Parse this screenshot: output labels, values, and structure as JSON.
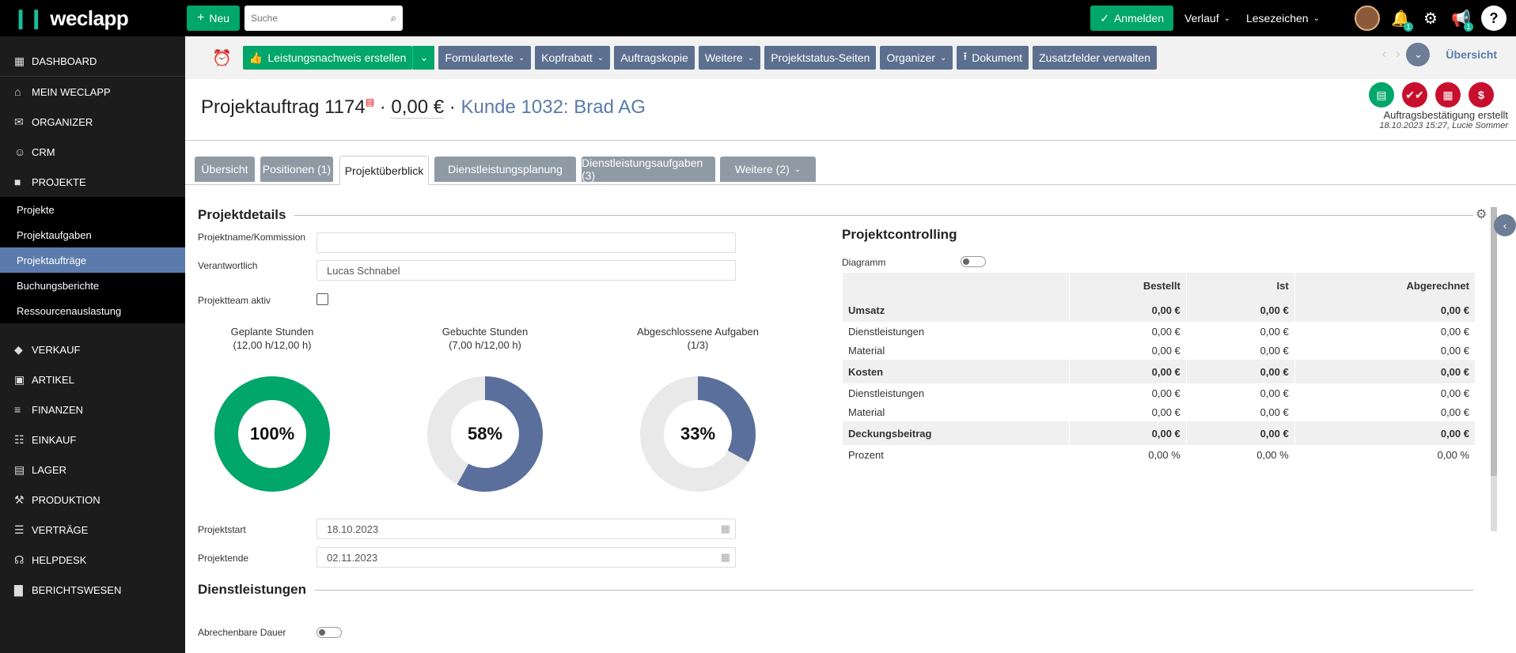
{
  "app": {
    "logo": "weclapp"
  },
  "topbar": {
    "new_label": "Neu",
    "search_placeholder": "Suche",
    "login_label": "Anmelden",
    "history_label": "Verlauf",
    "bookmarks_label": "Lesezeichen",
    "notif_count": "1",
    "announce_count": "1",
    "help_label": "?"
  },
  "sidebar": {
    "items": [
      {
        "label": "Dashboard",
        "icon": "dashboard-icon"
      },
      {
        "label": "Mein weclapp",
        "icon": "home-icon"
      },
      {
        "label": "Organizer",
        "icon": "mail-icon"
      },
      {
        "label": "CRM",
        "icon": "users-icon"
      },
      {
        "label": "Projekte",
        "icon": "briefcase-icon"
      }
    ],
    "subitems": [
      "Projekte",
      "Projektaufgaben",
      "Projektaufträge",
      "Buchungsberichte",
      "Ressourcenauslastung"
    ],
    "items2": [
      {
        "label": "Verkauf",
        "icon": "tag-icon"
      },
      {
        "label": "Artikel",
        "icon": "box-icon"
      },
      {
        "label": "Finanzen",
        "icon": "bank-icon"
      },
      {
        "label": "Einkauf",
        "icon": "cart-icon"
      },
      {
        "label": "Lager",
        "icon": "warehouse-icon"
      },
      {
        "label": "Produktion",
        "icon": "wrench-icon"
      },
      {
        "label": "Verträge",
        "icon": "contract-icon"
      },
      {
        "label": "Helpdesk",
        "icon": "headset-icon"
      },
      {
        "label": "Berichtswesen",
        "icon": "chart-icon"
      }
    ]
  },
  "toolbar": {
    "buttons": [
      "Leistungsnachweis erstellen",
      "Formulartexte",
      "Kopfrabatt",
      "Auftragskopie",
      "Weitere",
      "Projektstatus-Seiten",
      "Organizer",
      "Dokument",
      "Zusatzfelder verwalten"
    ],
    "overview_link": "Übersicht"
  },
  "header": {
    "title": "Projektauftrag 1174",
    "amount": "0,00 €",
    "separator": "·",
    "customer": "Kunde 1032: Brad AG",
    "status_text": "Auftragsbestätigung erstellt",
    "status_sub": "18.10.2023 15:27, Lucie Sommer"
  },
  "tabs": [
    "Übersicht",
    "Positionen (1)",
    "Projektüberblick",
    "Dienstleistungsplanung",
    "Dienstleistungsaufgaben (3)",
    "Weitere (2)"
  ],
  "details": {
    "title": "Projektdetails",
    "name_label": "Projektname/Kommission",
    "name_value": "",
    "responsible_label": "Verantwortlich",
    "responsible_value": "Lucas Schnabel",
    "team_label": "Projektteam aktiv",
    "start_label": "Projektstart",
    "start_value": "18.10.2023",
    "end_label": "Projektende",
    "end_value": "02.11.2023"
  },
  "donuts": [
    {
      "title": "Geplante Stunden",
      "sub": "(12,00 h/12,00 h)",
      "percent_label": "100%",
      "fraction": 1.0,
      "color": "#00a66a"
    },
    {
      "title": "Gebuchte Stunden",
      "sub": "(7,00 h/12,00 h)",
      "percent_label": "58%",
      "fraction": 0.58,
      "color": "#5a6f9c"
    },
    {
      "title": "Abgeschlossene Aufgaben",
      "sub": "(1/3)",
      "percent_label": "33%",
      "fraction": 0.33,
      "color": "#5a6f9c"
    }
  ],
  "controlling": {
    "title": "Projektcontrolling",
    "diagram_label": "Diagramm",
    "headers": [
      "",
      "Bestellt",
      "Ist",
      "Abgerechnet"
    ],
    "rows": [
      {
        "type": "grp",
        "cells": [
          "Umsatz",
          "0,00 €",
          "0,00 €",
          "0,00 €"
        ]
      },
      {
        "type": "row",
        "cells": [
          "Dienstleistungen",
          "0,00 €",
          "0,00 €",
          "0,00 €"
        ]
      },
      {
        "type": "row",
        "cells": [
          "Material",
          "0,00 €",
          "0,00 €",
          "0,00 €"
        ]
      },
      {
        "type": "grp",
        "cells": [
          "Kosten",
          "0,00 €",
          "0,00 €",
          "0,00 €"
        ]
      },
      {
        "type": "row",
        "cells": [
          "Dienstleistungen",
          "0,00 €",
          "0,00 €",
          "0,00 €"
        ]
      },
      {
        "type": "row",
        "cells": [
          "Material",
          "0,00 €",
          "0,00 €",
          "0,00 €"
        ]
      },
      {
        "type": "grp",
        "cells": [
          "Deckungsbeitrag",
          "0,00 €",
          "0,00 €",
          "0,00 €"
        ]
      },
      {
        "type": "row",
        "cells": [
          "Prozent",
          "0,00 %",
          "0,00 %",
          "0,00 %"
        ]
      }
    ]
  },
  "services": {
    "title": "Dienstleistungen",
    "billable_label": "Abrechenbare Dauer"
  }
}
